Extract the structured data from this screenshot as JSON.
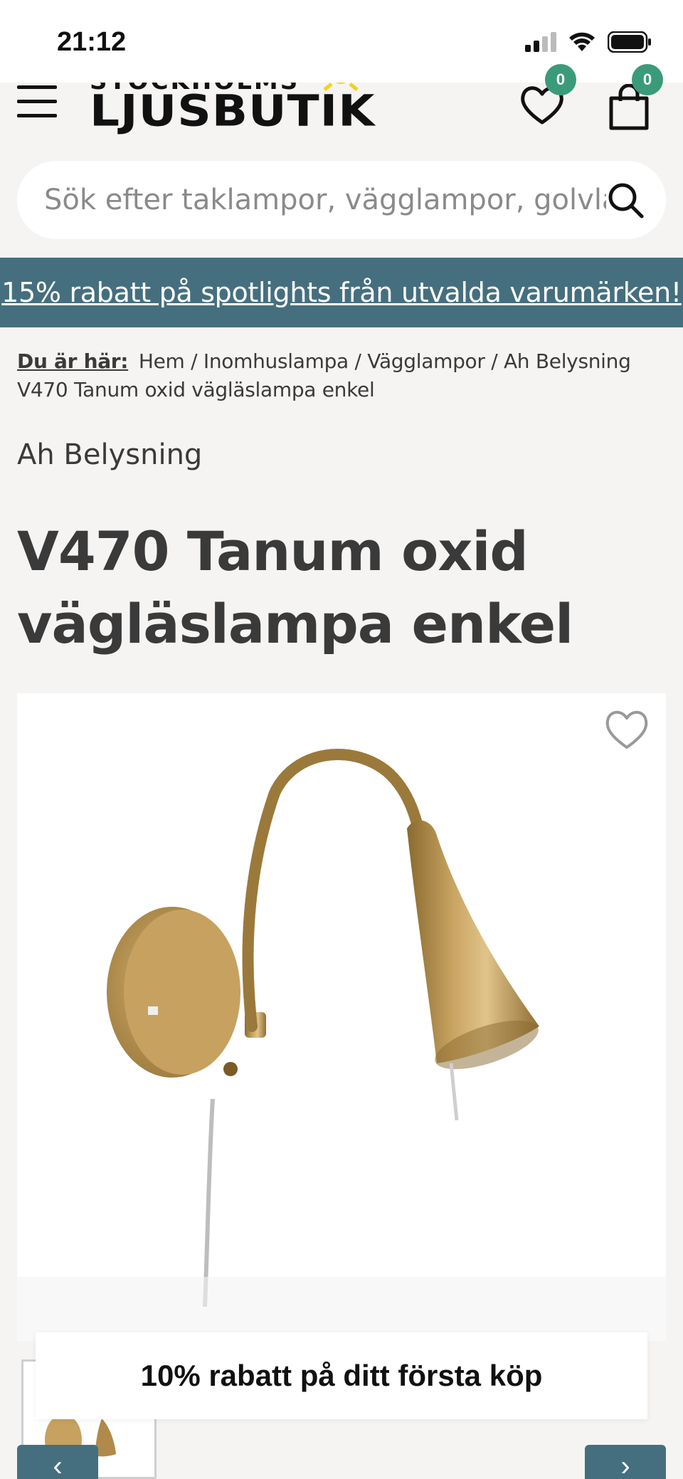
{
  "status_bar": {
    "time": "21:12"
  },
  "header": {
    "logo_top": "STOCKHOLMS",
    "logo_main": "LJUSBUTIK",
    "favorites_count": "0",
    "cart_count": "0"
  },
  "search": {
    "placeholder": "Sök efter taklampor, vägglampor, golvlampor"
  },
  "promo": {
    "text": "15% rabatt på spotlights från utvalda varumärken!"
  },
  "breadcrumb": {
    "label": "Du är här:",
    "items": [
      "Hem",
      "Inomhuslampa",
      "Vägglampor",
      "Ah Belysning",
      "V470 Tanum oxid vägläslampa enkel"
    ],
    "separator": "/"
  },
  "product": {
    "brand": "Ah Belysning",
    "title": "V470 Tanum oxid vägläslampa enkel"
  },
  "discount_banner": {
    "text": "10% rabatt på ditt första köp"
  },
  "carousel": {
    "prev_label": "‹",
    "next_label": "›"
  },
  "colors": {
    "accent": "#456f7e",
    "badge": "#3a9b7a",
    "background": "#f5f4f2",
    "brass": "#b08a4a"
  }
}
